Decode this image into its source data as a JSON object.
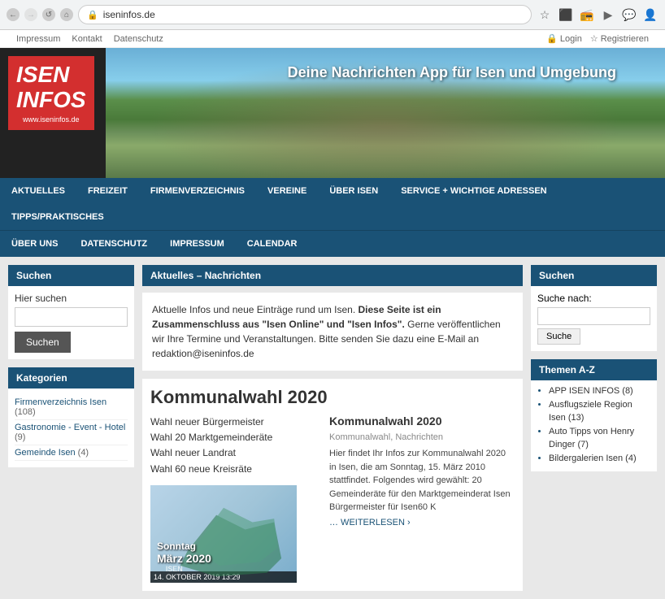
{
  "browser": {
    "url": "iseninfos.de",
    "back_label": "←",
    "forward_label": "→",
    "reload_label": "↺",
    "icons": [
      "☆",
      "🔒",
      "▶",
      "📻",
      "💬",
      "👤"
    ]
  },
  "topbar": {
    "links": [
      "Impressum",
      "Kontakt",
      "Datenschutz"
    ],
    "auth_links": [
      {
        "icon": "🔒",
        "label": "Login"
      },
      {
        "icon": "☆",
        "label": "Registrieren"
      }
    ]
  },
  "header": {
    "logo_line1": "ISEN",
    "logo_line2": "INFOS",
    "logo_url": "www.iseninfos.de",
    "tagline": "Deine Nachrichten App für Isen und Umgebung"
  },
  "nav_primary": {
    "items": [
      "AKTUELLES",
      "FREIZEIT",
      "FIRMENVERZEICHNIS",
      "VEREINE",
      "ÜBER ISEN",
      "SERVICE + WICHTIGE ADRESSEN",
      "TIPPS/PRAKTISCHES"
    ]
  },
  "nav_secondary": {
    "items": [
      "ÜBER UNS",
      "DATENSCHUTZ",
      "IMPRESSUM",
      "CALENDAR"
    ]
  },
  "sidebar_left": {
    "search_widget_title": "Suchen",
    "search_label": "Hier suchen",
    "search_placeholder": "",
    "search_button": "Suchen",
    "categories_title": "Kategorien",
    "categories": [
      {
        "name": "Firmenverzeichnis Isen",
        "count": "(108)"
      },
      {
        "name": "Gastronomie - Event - Hotel",
        "count": "(9)"
      },
      {
        "name": "Gemeinde Isen",
        "count": "(4)"
      }
    ]
  },
  "main_content": {
    "header": "Aktuelles – Nachrichten",
    "intro": "Aktuelle Infos und neue Einträge rund um Isen. ",
    "intro_bold": "Diese Seite ist ein Zusammenschluss aus \"Isen Online\" und \"Isen Infos\".",
    "intro_cont": " Gerne veröffentlichen wir Ihre Termine und Veranstaltungen.  Bitte senden Sie dazu eine E-Mail an redaktion@iseninfos.de",
    "article": {
      "title": "Kommunalwahl 2020",
      "bullets": [
        "Wahl neuer Bürgermeister",
        "Wahl 20 Marktgemeinderäte",
        "Wahl neuer Landrat",
        "Wahl 60 neue Kreisräte"
      ],
      "image_overlay": "Sonntag\nMärz 2020",
      "image_date": "14. OKTOBER 2019 13:29",
      "side_title": "Kommunalwahl 2020",
      "side_tags": "Kommunalwahl, Nachrichten",
      "side_body": "Hier findet Ihr Infos zur Kommunalwahl 2020 in Isen, die am Sonntag, 15. März 2010 stattfindet. Folgendes wird gewählt: 20 Gemeinderäte für den Marktgemeinderat Isen Bürgermeister für Isen60 K",
      "read_more": "… WEITERLESEN ›"
    }
  },
  "sidebar_right": {
    "search_title": "Suchen",
    "search_label": "Suche nach:",
    "search_button": "Suche",
    "themen_title": "Themen A-Z",
    "themen": [
      {
        "label": "APP ISEN INFOS",
        "count": "(8)"
      },
      {
        "label": "Ausflugsziele Region Isen",
        "count": "(13)"
      },
      {
        "label": "Auto Tipps von Henry Dinger",
        "count": "(7)"
      },
      {
        "label": "Bildergalerien Isen",
        "count": "(4)"
      }
    ]
  }
}
